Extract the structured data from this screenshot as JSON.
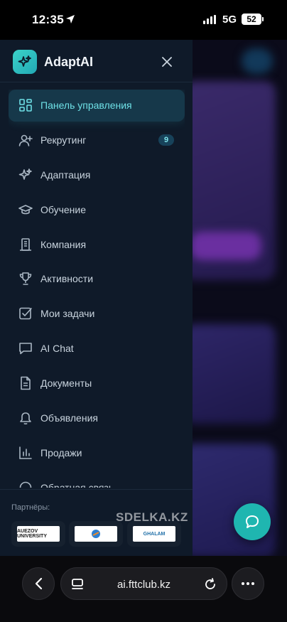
{
  "status_bar": {
    "time": "12:35",
    "network": "5G",
    "battery": "52"
  },
  "drawer": {
    "brand": "AdaptAI",
    "nav": [
      {
        "label": "Панель управления",
        "icon": "dashboard-icon",
        "active": true
      },
      {
        "label": "Рекрутинг",
        "icon": "user-plus-icon",
        "badge": "9"
      },
      {
        "label": "Адаптация",
        "icon": "sparkles-icon"
      },
      {
        "label": "Обучение",
        "icon": "graduation-cap-icon"
      },
      {
        "label": "Компания",
        "icon": "building-icon"
      },
      {
        "label": "Активности",
        "icon": "trophy-icon"
      },
      {
        "label": "Мои задачи",
        "icon": "checkbox-icon"
      },
      {
        "label": "AI Chat",
        "icon": "chat-bubble-icon"
      },
      {
        "label": "Документы",
        "icon": "document-icon"
      },
      {
        "label": "Объявления",
        "icon": "bell-icon"
      },
      {
        "label": "Продажи",
        "icon": "bar-chart-icon"
      },
      {
        "label": "Обратная связь",
        "icon": "feedback-icon"
      }
    ],
    "partners_title": "Партнёры:",
    "partners": [
      {
        "name": "AUEZOV UNIVERSITY"
      },
      {
        "name": ""
      },
      {
        "name": "GHALAM"
      }
    ]
  },
  "watermark": "SDELKA.KZ",
  "browser": {
    "url": "ai.fttclub.kz"
  },
  "colors": {
    "accent": "#1fb6b0",
    "drawer_bg": "#0f1a29",
    "active_item": "#16384a"
  }
}
